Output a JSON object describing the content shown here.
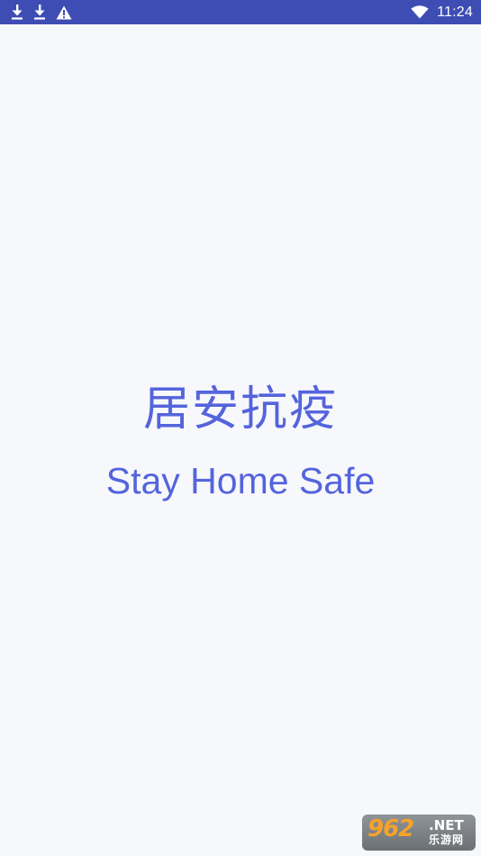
{
  "status_bar": {
    "time": "11:24",
    "left_icons": [
      "download-icon",
      "download-icon",
      "warning-icon"
    ],
    "right_icons": [
      "wifi-icon"
    ],
    "color": "#3d4db4"
  },
  "splash": {
    "title_cn": "居安抗疫",
    "title_en": "Stay Home Safe",
    "text_color": "#5464dc",
    "background": "#f7f8fc"
  },
  "watermark": {
    "number": "962",
    "suffix": ".NET",
    "site_cn": "乐游网"
  }
}
